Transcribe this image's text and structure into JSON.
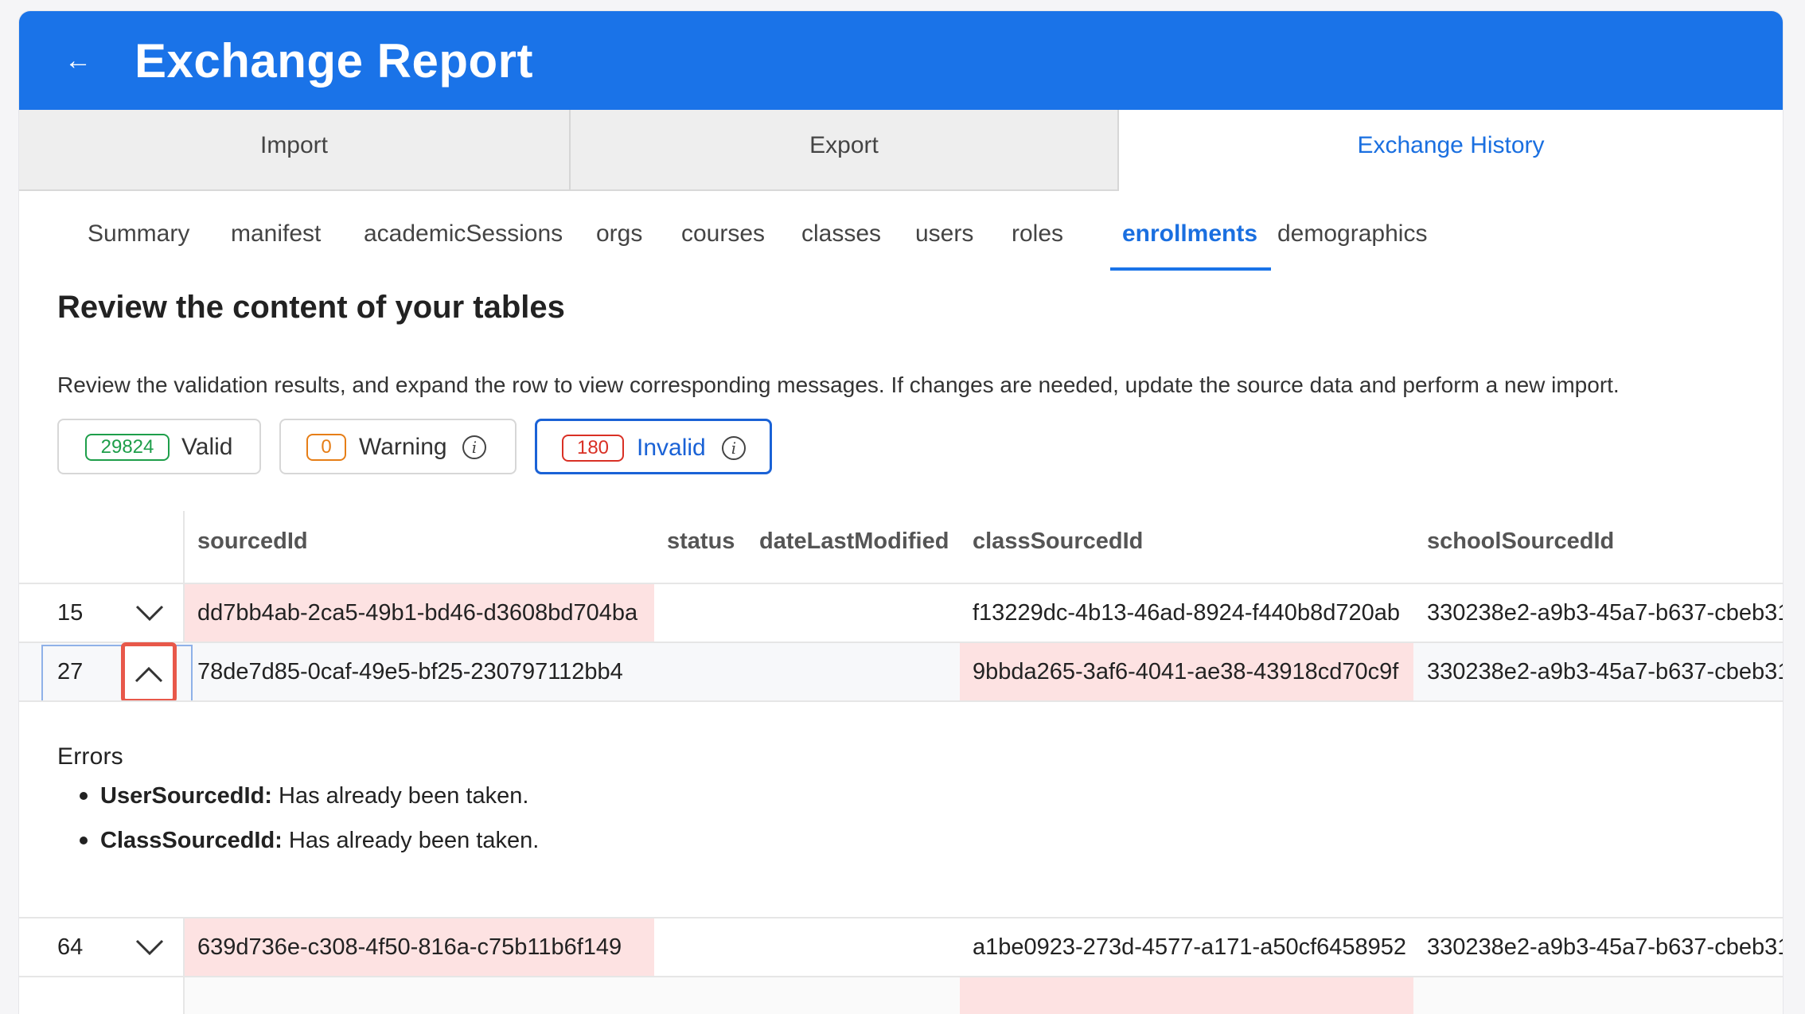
{
  "header": {
    "title": "Exchange Report",
    "back_icon": "arrow-left-icon"
  },
  "tabs": [
    {
      "label": "Import"
    },
    {
      "label": "Export"
    },
    {
      "label": "Exchange History",
      "active": true
    }
  ],
  "subtabs": [
    {
      "label": "Summary"
    },
    {
      "label": "manifest"
    },
    {
      "label": "academicSessions"
    },
    {
      "label": "orgs"
    },
    {
      "label": "courses"
    },
    {
      "label": "classes"
    },
    {
      "label": "users"
    },
    {
      "label": "roles"
    },
    {
      "label": "enrollments",
      "active": true
    },
    {
      "label": "demographics"
    }
  ],
  "section": {
    "title": "Review the content of your tables",
    "description": "Review the validation results, and expand the row to view corresponding messages. If changes are needed, update the source data and perform a new import."
  },
  "filters": {
    "valid": {
      "count": "29824",
      "label": "Valid",
      "color": "#1e9e4a"
    },
    "warning": {
      "count": "0",
      "label": "Warning",
      "color": "#e67e17"
    },
    "invalid": {
      "count": "180",
      "label": "Invalid",
      "color": "#d93025",
      "active": true
    }
  },
  "table": {
    "columns": [
      "sourcedId",
      "status",
      "dateLastModified",
      "classSourcedId",
      "schoolSourcedId"
    ],
    "rows": [
      {
        "num": "15",
        "sourcedId": "dd7bb4ab-2ca5-49b1-bd46-d3608bd704ba",
        "status": "",
        "dateLastModified": "",
        "classSourcedId": "f13229dc-4b13-46ad-8924-f440b8d720ab",
        "schoolSourcedId": "330238e2-a9b3-45a7-b637-cbeb31",
        "expanded": false
      },
      {
        "num": "27",
        "sourcedId": "78de7d85-0caf-49e5-bf25-230797112bb4",
        "status": "",
        "dateLastModified": "",
        "classSourcedId": "9bbda265-3af6-4041-ae38-43918cd70c9f",
        "schoolSourcedId": "330238e2-a9b3-45a7-b637-cbeb31",
        "expanded": true
      },
      {
        "num": "64",
        "sourcedId": "639d736e-c308-4f50-816a-c75b11b6f149",
        "status": "",
        "dateLastModified": "",
        "classSourcedId": "a1be0923-273d-4577-a171-a50cf6458952",
        "schoolSourcedId": "330238e2-a9b3-45a7-b637-cbeb31",
        "expanded": false
      }
    ]
  },
  "errors": {
    "title": "Errors",
    "items": [
      {
        "field": "UserSourcedId:",
        "message": " Has already been taken."
      },
      {
        "field": "ClassSourcedId:",
        "message": " Has already been taken."
      }
    ]
  },
  "colors": {
    "primary": "#1a73e8",
    "error_cell": "#fde2e2",
    "highlight_border": "#e8584a"
  }
}
